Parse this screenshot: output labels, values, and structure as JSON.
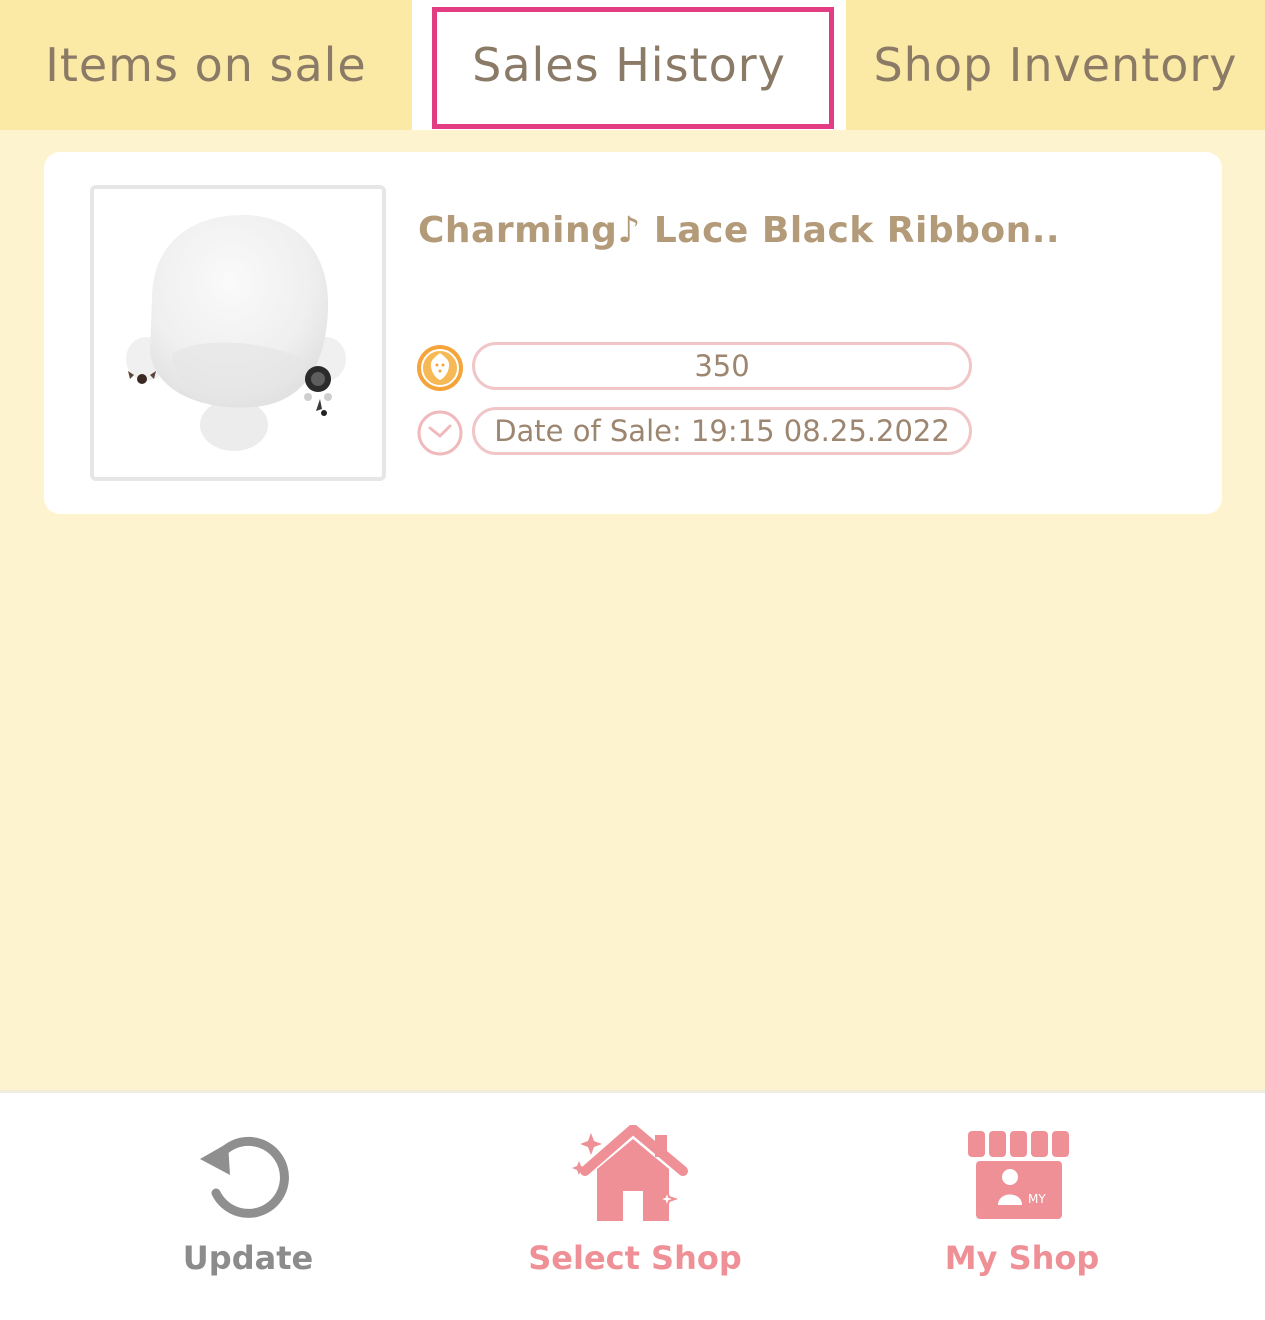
{
  "tabs": {
    "items_on_sale": "Items on sale",
    "sales_history": "Sales History",
    "shop_inventory": "Shop Inventory",
    "active": "Sales History"
  },
  "sale_record": {
    "item_name": "Charming♪ Lace Black Ribbon..",
    "price": "350",
    "date_of_sale": "Date of Sale: 19:15 08.25.2022",
    "currency_icon": "strawberry-coin-icon",
    "time_icon": "clock-icon"
  },
  "bottom_nav": {
    "update": "Update",
    "select_shop": "Select Shop",
    "my_shop": "My Shop",
    "my_badge": "MY"
  },
  "colors": {
    "background": "#fdf4cf",
    "tab_bar": "#fbeaa6",
    "active_tab_highlight": "#e23d83",
    "accent_pink": "#ee9096",
    "text_brown": "#8a7a66"
  }
}
